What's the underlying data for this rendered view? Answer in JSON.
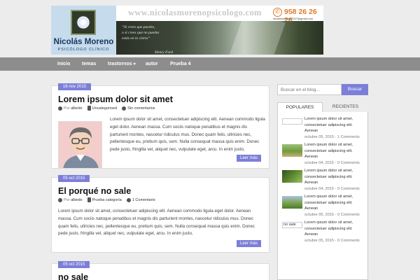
{
  "header": {
    "logo_name": "Nicolás Moreno",
    "logo_sub": "PSICÓLOGO CLÍNICO",
    "url": "www.nicolasmorenopsicologo.com",
    "phone": "958 26 26 26",
    "email": "nicolasmoreno2007@gmail.com",
    "quote": "“Si crees que puedes,\no si crees que no puedes\nestás en lo cierto”",
    "quote_author": "Henry Ford"
  },
  "nav": [
    {
      "label": "Inicio"
    },
    {
      "label": "temas"
    },
    {
      "label": "trastornos",
      "arrow": "▾"
    },
    {
      "label": "autor"
    },
    {
      "label": "Prueba 4"
    }
  ],
  "posts": [
    {
      "date": "16 nov 2015",
      "title": "Lorem ipsum dolor sit amet",
      "meta_prefix": "Por",
      "author": "albedo",
      "category": "Uncategorised",
      "comments": "Sin comentarios",
      "excerpt": "Lorem ipsum dolor sit amet, consectetuer adipiscing elit. Aenean commodo ligula eget dolor. Aenean massa. Cum sociis natoque penatibus et magnis dis parturient montes, nascetur ridiculus mus. Donec quam felis, ultricies nec, pellentesque eu, pretium quis, sem. Nulla consequat massa quis enim. Donec pede justo, fringilla vel, aliquet nec, vulputate eget, arcu. In enim justo,",
      "more": "Leer más"
    },
    {
      "date": "05 oct 2015",
      "title": "El porqué no sale",
      "meta_prefix": "Por",
      "author": "albedo",
      "category": "Prueba categoría",
      "comments": "1 Comentario",
      "excerpt": "Lorem ipsum dolor sit amet, consectetuer adipiscing elit. Aenean commodo ligula eget dolor. Aenean massa. Cum sociis natoque penatibus et magnis dis parturient montes, nascetur ridiculus mus. Donec quam felis, ultricies nec, pellentesque eu, pretium quis, sem. Nulla consequat massa quis enim. Donec pede justo, fringilla vel, aliquet nec, vulputate eget, arcu. In enim justo,",
      "more": "Leer más"
    },
    {
      "date": "05 oct 2015",
      "title": "no sale"
    }
  ],
  "sidebar": {
    "search_placeholder": "Buscar en el blog...",
    "search_button": "Buscar",
    "tabs": [
      {
        "label": "POPULARES"
      },
      {
        "label": "RECIENTES"
      }
    ],
    "popular": [
      {
        "title": "Lorem ipsum dolor sit amet, consectetuer adipiscing elit. Aenean",
        "date": "octubre 05, 2015 - 1 Comments",
        "thumb_alt": ""
      },
      {
        "title": "Lorem ipsum dolor sit amet, consectetuer adipiscing elit. Aenean",
        "date": "octubre 04, 2015 - 0 Comments",
        "thumb_alt": ""
      },
      {
        "title": "Lorem ipsum dolor sit amet, consectetuer adipiscing elit. Aenean",
        "date": "octubre 04, 2015 - 0 Comments",
        "thumb_alt": ""
      },
      {
        "title": "Lorem ipsum dolor sit amet, consectetuer adipiscing elit. Aenean",
        "date": "octubre 05, 2015 - 0 Comments",
        "thumb_alt": ""
      },
      {
        "title": "Lorem ipsum dolor sit amet, consectetuer adipiscing elit. Aenean",
        "date": "octubre 05, 2015 - 0 Comments",
        "thumb_alt": "no sale"
      }
    ]
  },
  "colors": {
    "accent": "#7c7fd8",
    "nav_bg": "#8d8d8d",
    "phone": "#e07a2a"
  }
}
